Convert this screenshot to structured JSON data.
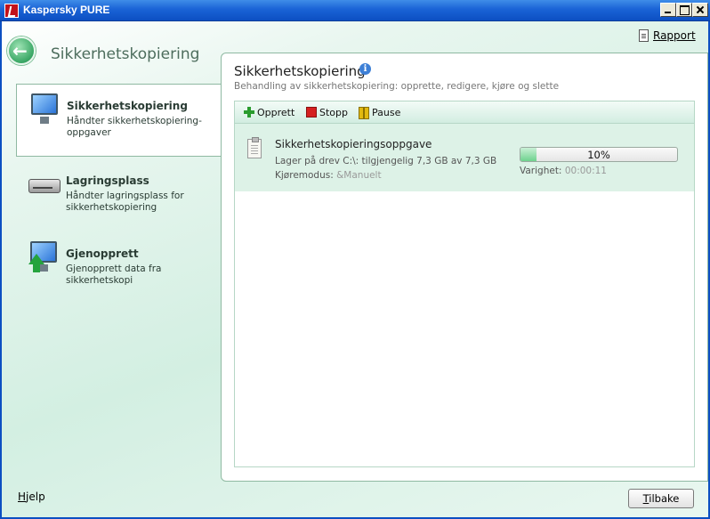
{
  "window": {
    "title": "Kaspersky PURE"
  },
  "header": {
    "section_title": "Sikkerhetskopiering",
    "report_label": "Rapport"
  },
  "sidebar": {
    "items": [
      {
        "title": "Sikkerhetskopiering",
        "subtitle": "Håndter sikkerhetskopiering-oppgaver",
        "active": true
      },
      {
        "title": "Lagringsplass",
        "subtitle": "Håndter lagringsplass for sikkerhetskopiering"
      },
      {
        "title": "Gjenopprett",
        "subtitle": "Gjenopprett data fra sikkerhetskopi"
      }
    ]
  },
  "main": {
    "title": "Sikkerhetskopiering",
    "info_icon": "i",
    "description": "Behandling av sikkerhetskopiering: opprette, redigere, kjøre og slette",
    "toolbar": {
      "create": "Opprett",
      "stop": "Stopp",
      "pause": "Pause"
    },
    "tasks": [
      {
        "name": "Sikkerhetskopieringsoppgave",
        "storage": "Lager på drev C:\\: tilgjengelig 7,3 GB av 7,3 GB",
        "mode_label": "Kjøremodus:",
        "mode_value": "&Manuelt",
        "progress_text": "10%",
        "progress_fraction": 0.1,
        "duration_label": "Varighet:",
        "duration_value": "00:00:11"
      }
    ]
  },
  "footer": {
    "help": "Hjelp",
    "back": "Tilbake"
  },
  "colors": {
    "titlebar": "#0c4fc2",
    "accent_green": "#3aa765",
    "row_highlight": "#ddf2e7"
  }
}
